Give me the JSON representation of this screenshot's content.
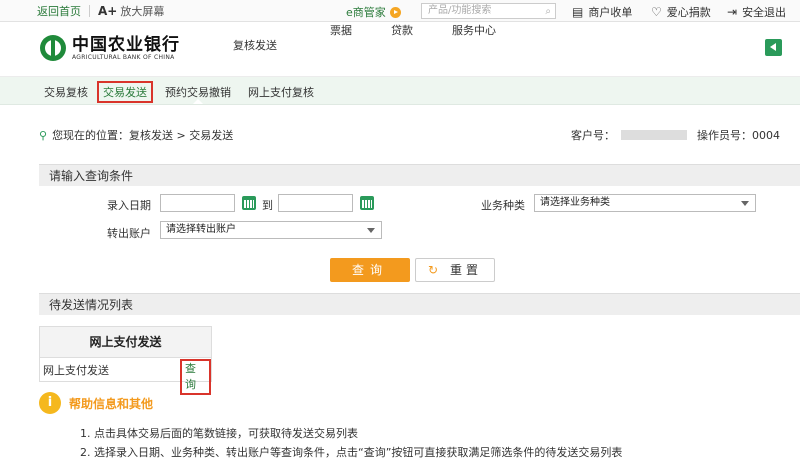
{
  "topbar": {
    "home": "返回首页",
    "bigscreen_prefix": "A+",
    "bigscreen": "放大屏幕",
    "emanager": "e商管家",
    "search_placeholder": "产品/功能搜索",
    "merchant": "商户收单",
    "charity": "爱心捐款",
    "logout": "安全退出"
  },
  "brand": {
    "name_cn": "中国农业银行",
    "name_en": "AGRICULTURAL BANK OF CHINA"
  },
  "mainnav": [
    "复核发送",
    "票据",
    "贷款",
    "服务中心"
  ],
  "subnav": [
    "交易复核",
    "交易发送",
    "预约交易撤销",
    "网上支付复核"
  ],
  "location": "您现在的位置：复核发送 > 交易发送",
  "customer": {
    "label": "客户号：",
    "operator": "操作员号：0004"
  },
  "query": {
    "section_title": "请输入查询条件",
    "date_label": "录入日期",
    "to_label": "到",
    "biz_label": "业务种类",
    "biz_value": "请选择业务种类",
    "account_label": "转出账户",
    "account_value": "请选择转出账户",
    "query_btn": "查询",
    "reset_btn": "重置"
  },
  "pending": {
    "section_title": "待发送情况列表",
    "table_header": "网上支付发送",
    "row_label": "网上支付发送",
    "row_link": "查询"
  },
  "help": {
    "title": "帮助信息和其他",
    "lines": [
      "1. 点击具体交易后面的笔数链接，可获取待发送交易列表",
      "2. 选择录入日期、业务种类、转出账户等查询条件，点击“查询”按钮可直接获取满足筛选条件的待发送交易列表"
    ]
  }
}
